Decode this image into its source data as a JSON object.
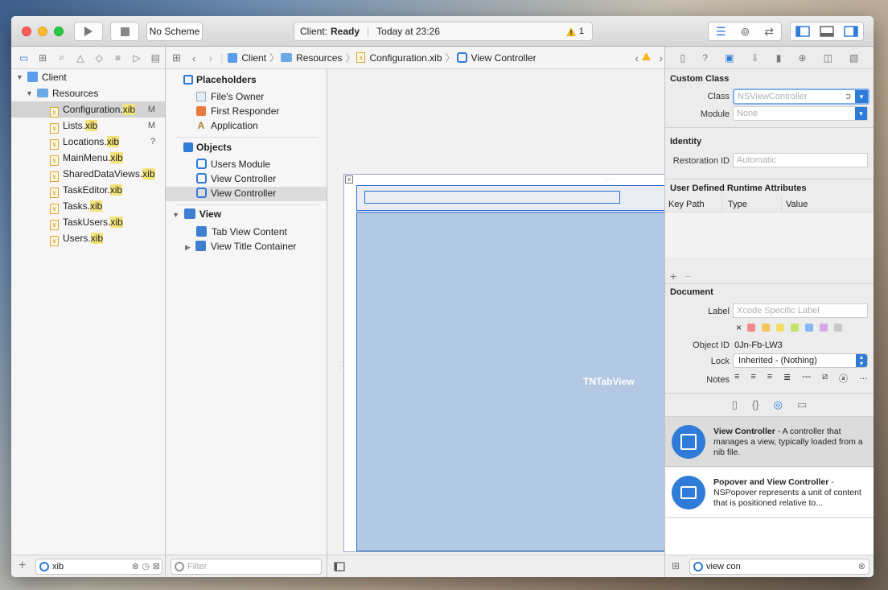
{
  "toolbar": {
    "scheme": "No Scheme",
    "status_label": "Client:",
    "status_value": "Ready",
    "status_time": "Today at 23:26",
    "warning_count": "1"
  },
  "navigator": {
    "project": "Client",
    "group": "Resources",
    "files": [
      {
        "base": "Configuration.",
        "ext": "xib",
        "flag": "M",
        "selected": true
      },
      {
        "base": "Lists.",
        "ext": "xib",
        "flag": "M"
      },
      {
        "base": "Locations.",
        "ext": "xib",
        "flag": "?"
      },
      {
        "base": "MainMenu.",
        "ext": "xib",
        "flag": ""
      },
      {
        "base": "SharedDataViews.",
        "ext": "xib",
        "flag": ""
      },
      {
        "base": "TaskEditor.",
        "ext": "xib",
        "flag": ""
      },
      {
        "base": "Tasks.",
        "ext": "xib",
        "flag": ""
      },
      {
        "base": "TaskUsers.",
        "ext": "xib",
        "flag": ""
      },
      {
        "base": "Users.",
        "ext": "xib",
        "flag": ""
      }
    ],
    "filter_value": "xib"
  },
  "jumpbar": {
    "crumbs": [
      "Client",
      "Resources",
      "Configuration.xib",
      "View Controller"
    ]
  },
  "outline": {
    "placeholders_title": "Placeholders",
    "placeholders": [
      "File's Owner",
      "First Responder",
      "Application"
    ],
    "objects_title": "Objects",
    "objects": [
      "Users Module",
      "View Controller",
      "View Controller"
    ],
    "view_title": "View",
    "view_children": [
      "Tab View Content",
      "View Title Container"
    ],
    "filter_placeholder": "Filter"
  },
  "canvas": {
    "view_label": "TNTabView"
  },
  "inspector": {
    "custom_class_title": "Custom Class",
    "class_label": "Class",
    "class_placeholder": "NSViewController",
    "module_label": "Module",
    "module_placeholder": "None",
    "identity_title": "Identity",
    "restoration_label": "Restoration ID",
    "restoration_placeholder": "Automatic",
    "runtime_title": "User Defined Runtime Attributes",
    "col_keypath": "Key Path",
    "col_type": "Type",
    "col_value": "Value",
    "document_title": "Document",
    "doc_label_label": "Label",
    "doc_label_placeholder": "Xcode Specific Label",
    "object_id_label": "Object ID",
    "object_id_value": "0Jn-Fb-LW3",
    "lock_label": "Lock",
    "lock_value": "Inherited - (Nothing)",
    "notes_label": "Notes",
    "swatch_colors": [
      "#f08a8a",
      "#f3c35c",
      "#f0e06a",
      "#c6e06a",
      "#8ab8f0",
      "#d9a8e8",
      "#c8c8c8"
    ]
  },
  "library": {
    "items": [
      {
        "title": "View Controller",
        "desc": " - A controller that manages a view, typically loaded from a nib file."
      },
      {
        "title": "Popover and View Controller",
        "desc": " - NSPopover represents a unit of content that is positioned relative to..."
      }
    ],
    "filter_value": "view con"
  }
}
